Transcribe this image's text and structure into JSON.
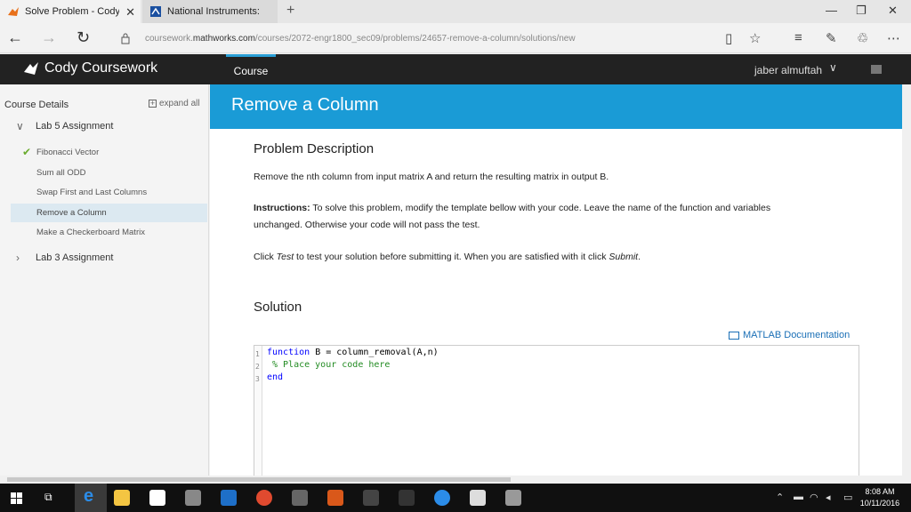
{
  "browser": {
    "tabs": [
      {
        "title": "Solve Problem - Cody C",
        "active": true
      },
      {
        "title": "National Instruments: Test, I",
        "active": false
      }
    ],
    "url_prefix": "coursework.",
    "url_domain": "mathworks.com",
    "url_path": "/courses/2072-engr1800_sec09/problems/24657-remove-a-column/solutions/new"
  },
  "header": {
    "brand": "Cody Coursework",
    "nav_tab": "Course",
    "user": "jaber almuftah"
  },
  "sidebar": {
    "heading": "Course Details",
    "expand_label": "expand all",
    "groups": [
      {
        "label": "Lab 5 Assignment",
        "expanded": true,
        "items": [
          {
            "label": "Fibonacci Vector",
            "completed": true,
            "active": false
          },
          {
            "label": "Sum all ODD",
            "completed": false,
            "active": false
          },
          {
            "label": "Swap First and Last Columns",
            "completed": false,
            "active": false
          },
          {
            "label": "Remove a Column",
            "completed": false,
            "active": true
          },
          {
            "label": "Make a Checkerboard Matrix",
            "completed": false,
            "active": false
          }
        ]
      },
      {
        "label": "Lab 3 Assignment",
        "expanded": false
      }
    ]
  },
  "main": {
    "title": "Remove a Column",
    "problem_heading": "Problem Description",
    "problem_text": "Remove the nth column from input matrix A and return the resulting matrix in output B.",
    "instructions_label": "Instructions:",
    "instructions_text": " To solve this problem, modify the template bellow with your code. Leave the name of the function and variables",
    "instructions_text2": "unchanged. Otherwise your code will not pass the test.",
    "click_text_1": "Click ",
    "click_test": "Test",
    "click_text_2": " to test your solution before submitting it. When you are satisfied with it click ",
    "click_submit": "Submit",
    "click_text_3": ".",
    "solution_heading": "Solution",
    "doc_link": "MATLAB Documentation",
    "code_lines": [
      {
        "num": "1",
        "keyword": "function",
        "rest": " B = column_removal(A,n)"
      },
      {
        "num": "2",
        "comment": "% Place your code here"
      },
      {
        "num": "3",
        "keyword": "end"
      }
    ]
  },
  "taskbar": {
    "time": "8:08 AM",
    "date": "10/11/2016"
  },
  "colors": {
    "accent": "#1a9bd6",
    "header_bg": "#222222",
    "active_item_bg": "#dce9f1",
    "check_green": "#6aab2e"
  }
}
